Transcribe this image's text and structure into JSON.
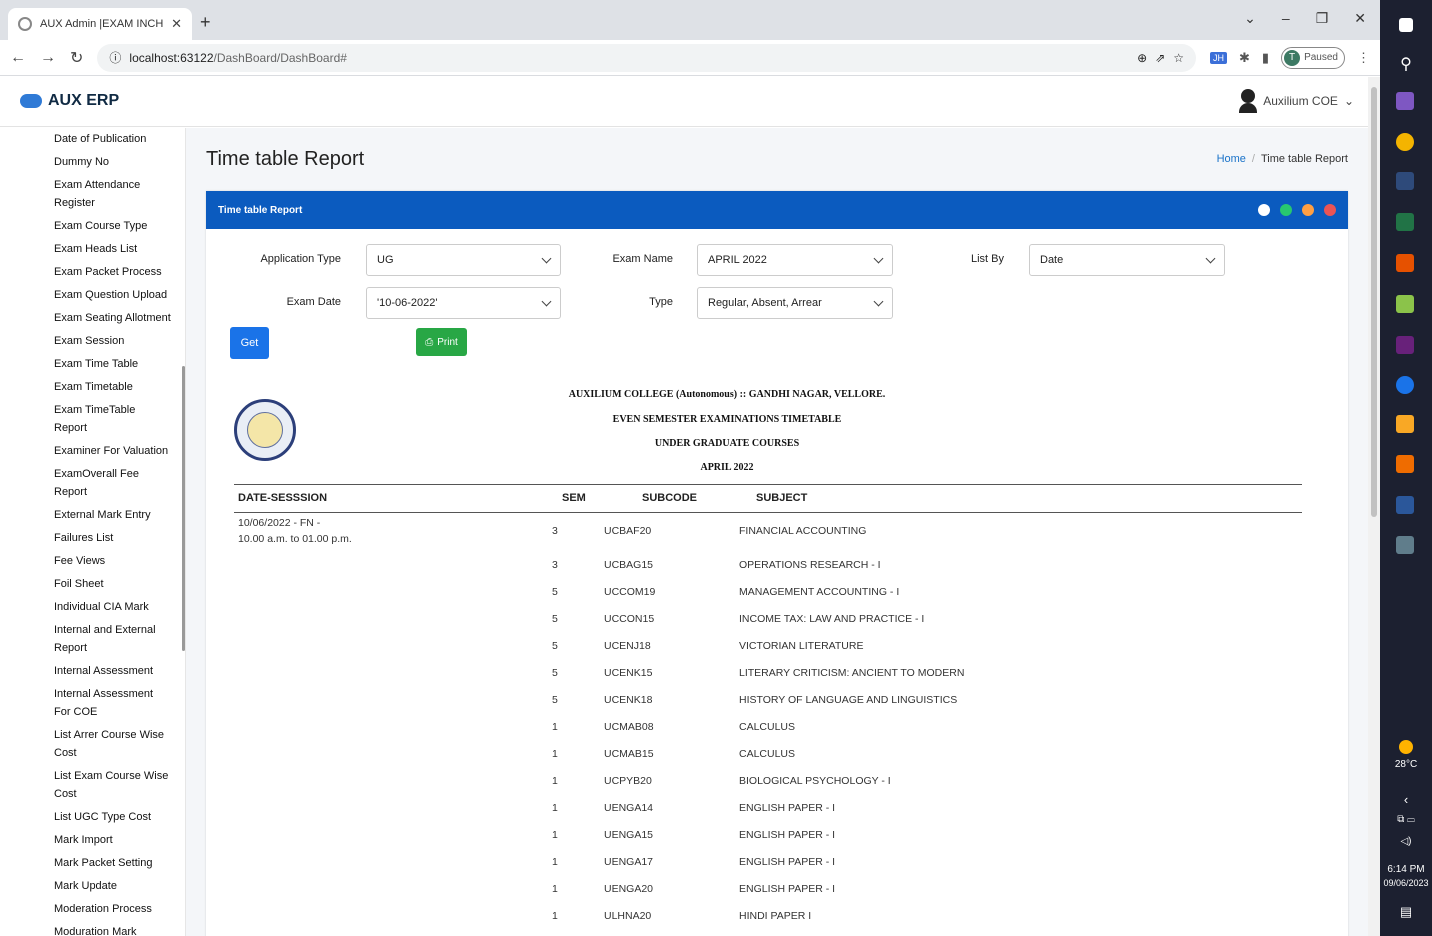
{
  "browser": {
    "tab_title": "AUX Admin |EXAM INCHARGE",
    "url_host": "localhost:63122",
    "url_path": "/DashBoard/DashBoard#",
    "profile_status": "Paused",
    "profile_initial": "T"
  },
  "app": {
    "brand": "AUX ERP",
    "user_name": "Auxilium COE"
  },
  "sidebar": {
    "items": [
      "Date of Publication",
      "Dummy No",
      "Exam Attendance Register",
      "Exam Course Type",
      "Exam Heads List",
      "Exam Packet Process",
      "Exam Question Upload",
      "Exam Seating Allotment",
      "Exam Session",
      "Exam Time Table",
      "Exam Timetable",
      "Exam TimeTable Report",
      "Examiner For Valuation",
      "ExamOverall Fee Report",
      "External Mark Entry",
      "Failures List",
      "Fee Views",
      "Foil Sheet",
      "Individual CIA Mark",
      "Internal and External Report",
      "Internal Assessment",
      "Internal Assessment For COE",
      "List Arrer Course Wise Cost",
      "List Exam Course Wise Cost",
      "List UGC Type Cost",
      "Mark Import",
      "Mark Packet Setting",
      "Mark Update",
      "Moderation Process",
      "Moduration Mark Distributor"
    ]
  },
  "page": {
    "title": "Time table Report",
    "breadcrumb_home": "Home",
    "breadcrumb_current": "Time table Report",
    "card_title": "Time table Report"
  },
  "form": {
    "application_type_label": "Application Type",
    "application_type_value": "UG",
    "exam_name_label": "Exam Name",
    "exam_name_value": "APRIL 2022",
    "list_by_label": "List By",
    "list_by_value": "Date",
    "exam_date_label": "Exam Date",
    "exam_date_value": "'10-06-2022'",
    "type_label": "Type",
    "type_value": "Regular, Absent, Arrear",
    "get_button": "Get",
    "print_button": "Print"
  },
  "report": {
    "line1": "AUXILIUM COLLEGE (Autonomous) :: GANDHI NAGAR, VELLORE.",
    "line2": "EVEN SEMESTER EXAMINATIONS TIMETABLE",
    "line3": "UNDER GRADUATE COURSES",
    "line4": "APRIL 2022",
    "headers": {
      "date_session": "DATE-SESSSION",
      "sem": "SEM",
      "subcode": "SUBCODE",
      "subject": "SUBJECT"
    },
    "date_line1": "10/06/2022 - FN -",
    "date_line2": "10.00 a.m. to 01.00 p.m.",
    "rows": [
      {
        "sem": "3",
        "subcode": "UCBAF20",
        "subject": "FINANCIAL ACCOUNTING"
      },
      {
        "sem": "3",
        "subcode": "UCBAG15",
        "subject": "OPERATIONS RESEARCH - I"
      },
      {
        "sem": "5",
        "subcode": "UCCOM19",
        "subject": "MANAGEMENT ACCOUNTING - I"
      },
      {
        "sem": "5",
        "subcode": "UCCON15",
        "subject": "INCOME TAX: LAW AND PRACTICE - I"
      },
      {
        "sem": "5",
        "subcode": "UCENJ18",
        "subject": "VICTORIAN LITERATURE"
      },
      {
        "sem": "5",
        "subcode": "UCENK15",
        "subject": "LITERARY CRITICISM: ANCIENT TO MODERN"
      },
      {
        "sem": "5",
        "subcode": "UCENK18",
        "subject": "HISTORY OF LANGUAGE AND LINGUISTICS"
      },
      {
        "sem": "1",
        "subcode": "UCMAB08",
        "subject": "CALCULUS"
      },
      {
        "sem": "1",
        "subcode": "UCMAB15",
        "subject": "CALCULUS"
      },
      {
        "sem": "1",
        "subcode": "UCPYB20",
        "subject": "BIOLOGICAL PSYCHOLOGY - I"
      },
      {
        "sem": "1",
        "subcode": "UENGA14",
        "subject": "ENGLISH PAPER - I"
      },
      {
        "sem": "1",
        "subcode": "UENGA15",
        "subject": "ENGLISH PAPER - I"
      },
      {
        "sem": "1",
        "subcode": "UENGA17",
        "subject": "ENGLISH PAPER - I"
      },
      {
        "sem": "1",
        "subcode": "UENGA20",
        "subject": "ENGLISH PAPER - I"
      },
      {
        "sem": "1",
        "subcode": "ULHNA20",
        "subject": "HINDI PAPER I"
      }
    ]
  },
  "taskbar": {
    "temperature": "28°C",
    "time": "6:14 PM",
    "date": "09/06/2023"
  },
  "colors": {
    "card_header": "#0b5bbf",
    "get_button": "#1a73e8",
    "print_button": "#28a745",
    "card_dots": [
      "#ffffff",
      "#28c76f",
      "#ff9f43",
      "#ea5455"
    ]
  }
}
